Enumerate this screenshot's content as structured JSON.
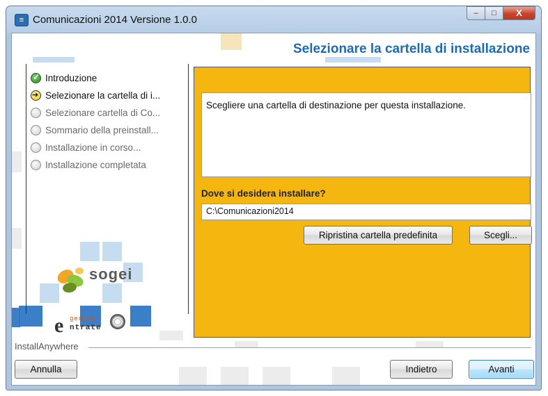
{
  "window": {
    "title": "Comunicazioni 2014 Versione 1.0.0",
    "controls": {
      "minimize": "–",
      "maximize": "□",
      "close": "X"
    }
  },
  "header": {
    "title": "Selezionare la cartella di installazione"
  },
  "steps": [
    {
      "label": "Introduzione",
      "state": "done"
    },
    {
      "label": "Selezionare la cartella di i...",
      "state": "current"
    },
    {
      "label": "Selezionare cartella di Co...",
      "state": "pending"
    },
    {
      "label": "Sommario della preinstall...",
      "state": "pending"
    },
    {
      "label": "Installazione in corso...",
      "state": "pending"
    },
    {
      "label": "Installazione completata",
      "state": "pending"
    }
  ],
  "logos": {
    "sogei": "sogei",
    "agenzia_top": "genzia",
    "agenzia_bottom": "ntrate"
  },
  "main": {
    "description": "Scegliere una cartella di destinazione per questa installazione.",
    "prompt": "Dove si desidera installare?",
    "path_value": "C:\\Comunicazioni2014",
    "restore_button": "Ripristina cartella predefinita",
    "choose_button": "Scegli..."
  },
  "footer": {
    "brand": "InstallAnywhere",
    "cancel_button": "Annulla",
    "back_button": "Indietro",
    "next_button": "Avanti"
  },
  "colors": {
    "accent_panel": "#f5b70f",
    "header_title": "#1f6bb3"
  }
}
